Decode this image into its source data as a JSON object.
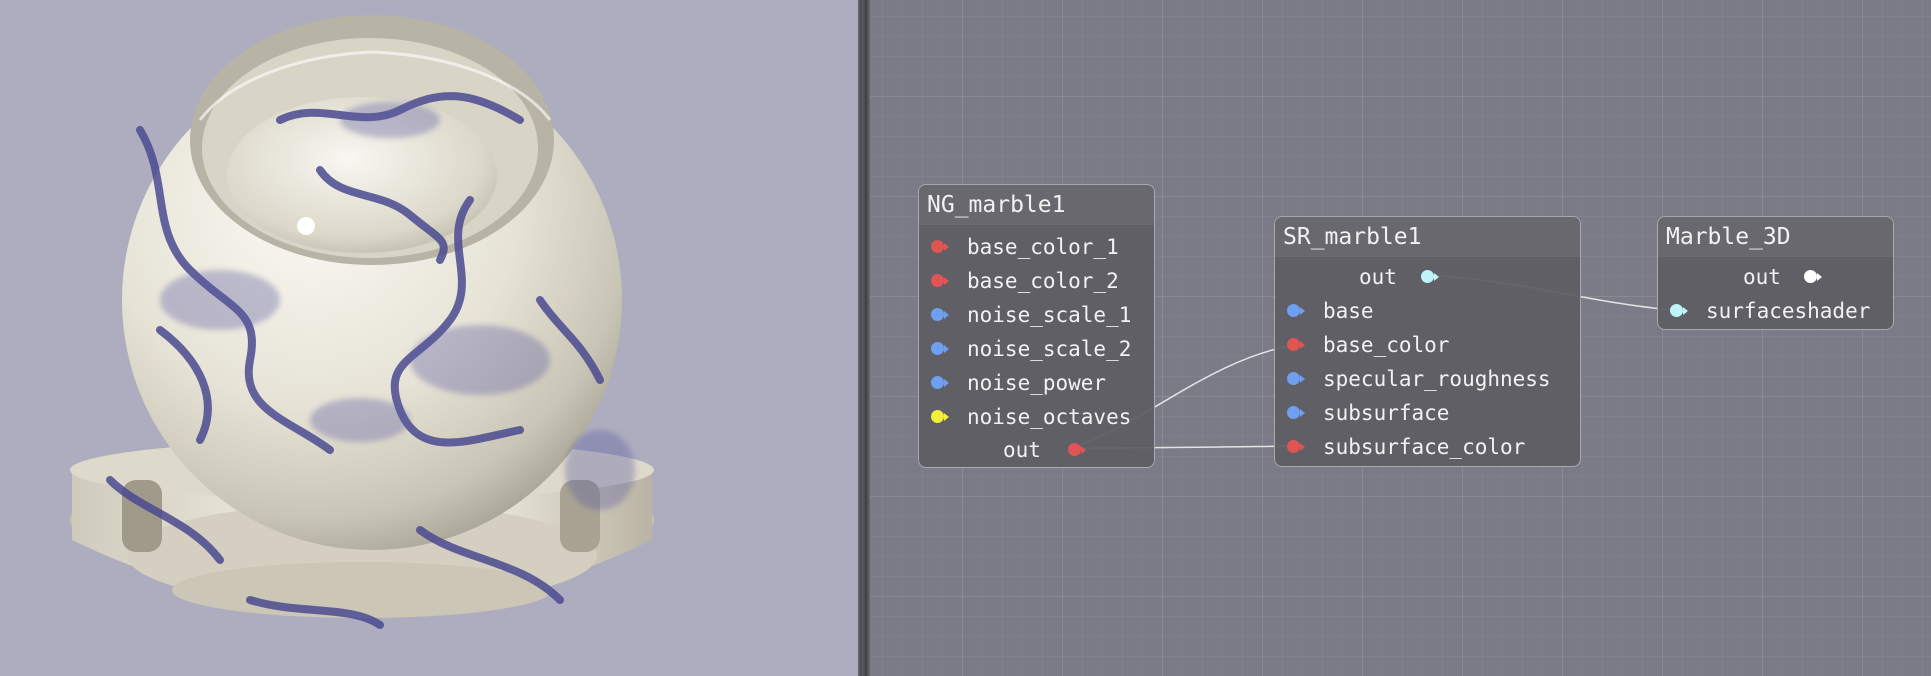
{
  "colors": {
    "port_color": "#e05454",
    "port_vector": "#6f9ff0",
    "port_integer": "#f2ee3a",
    "port_shader_out": "#bff4f8",
    "port_surfaceshader_in": "#bff4f8",
    "port_material_out": "#ffffff",
    "wire": "#e4e4e4",
    "node_bg": "#5c5c62",
    "graph_bg": "#7a7b87",
    "viewport_bg": "#adadbf",
    "marble_base": "#ece9dd",
    "marble_vein": "#4b4a90"
  },
  "nodes": [
    {
      "title": "NG_marble1",
      "inputs": [
        {
          "label": "base_color_1",
          "type": "color"
        },
        {
          "label": "base_color_2",
          "type": "color"
        },
        {
          "label": "noise_scale_1",
          "type": "vector"
        },
        {
          "label": "noise_scale_2",
          "type": "vector"
        },
        {
          "label": "noise_power",
          "type": "vector"
        },
        {
          "label": "noise_octaves",
          "type": "integer"
        }
      ],
      "outputs": [
        {
          "label": "out",
          "type": "color"
        }
      ]
    },
    {
      "title": "SR_marble1",
      "outputs": [
        {
          "label": "out",
          "type": "shader"
        }
      ],
      "inputs": [
        {
          "label": "base",
          "type": "vector"
        },
        {
          "label": "base_color",
          "type": "color"
        },
        {
          "label": "specular_roughness",
          "type": "vector"
        },
        {
          "label": "subsurface",
          "type": "vector"
        },
        {
          "label": "subsurface_color",
          "type": "color"
        }
      ]
    },
    {
      "title": "Marble_3D",
      "outputs": [
        {
          "label": "out",
          "type": "material"
        }
      ],
      "inputs": [
        {
          "label": "surfaceshader",
          "type": "shader"
        }
      ]
    }
  ]
}
